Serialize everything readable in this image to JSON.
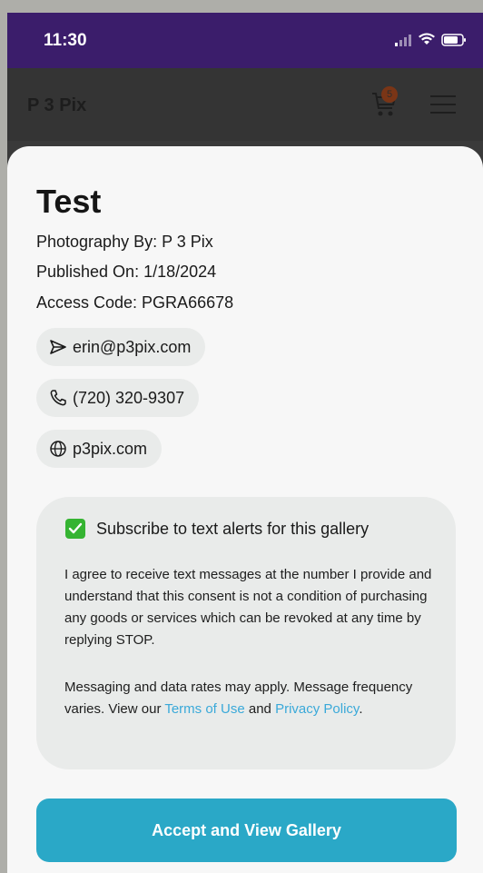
{
  "status_bar": {
    "time": "11:30"
  },
  "header": {
    "brand": "P 3 Pix",
    "cart_count": "5"
  },
  "gallery": {
    "title": "Test",
    "photography_by": "Photography By: P 3 Pix",
    "published_on": "Published On: 1/18/2024",
    "access_code": "Access Code: PGRA66678"
  },
  "contacts": {
    "email": "erin@p3pix.com",
    "phone": "(720) 320-9307",
    "website": "p3pix.com"
  },
  "consent": {
    "checkbox_checked": true,
    "checkbox_label": "Subscribe to text alerts for this gallery",
    "paragraph1": "I agree to receive text messages at the number I provide and understand that this consent is not a condition of purchasing any goods or services which can be revoked at any time by replying STOP.",
    "paragraph2_prefix": "Messaging and data rates may apply. Message frequency varies. View our ",
    "terms_link": "Terms of Use",
    "and_text": " and ",
    "privacy_link": "Privacy Policy",
    "period": "."
  },
  "actions": {
    "accept_button": "Accept and View Gallery"
  },
  "colors": {
    "status_bar": "#3b1d6b",
    "accent": "#2aa8c7",
    "checkbox": "#35b432",
    "link": "#3aa9d9"
  }
}
